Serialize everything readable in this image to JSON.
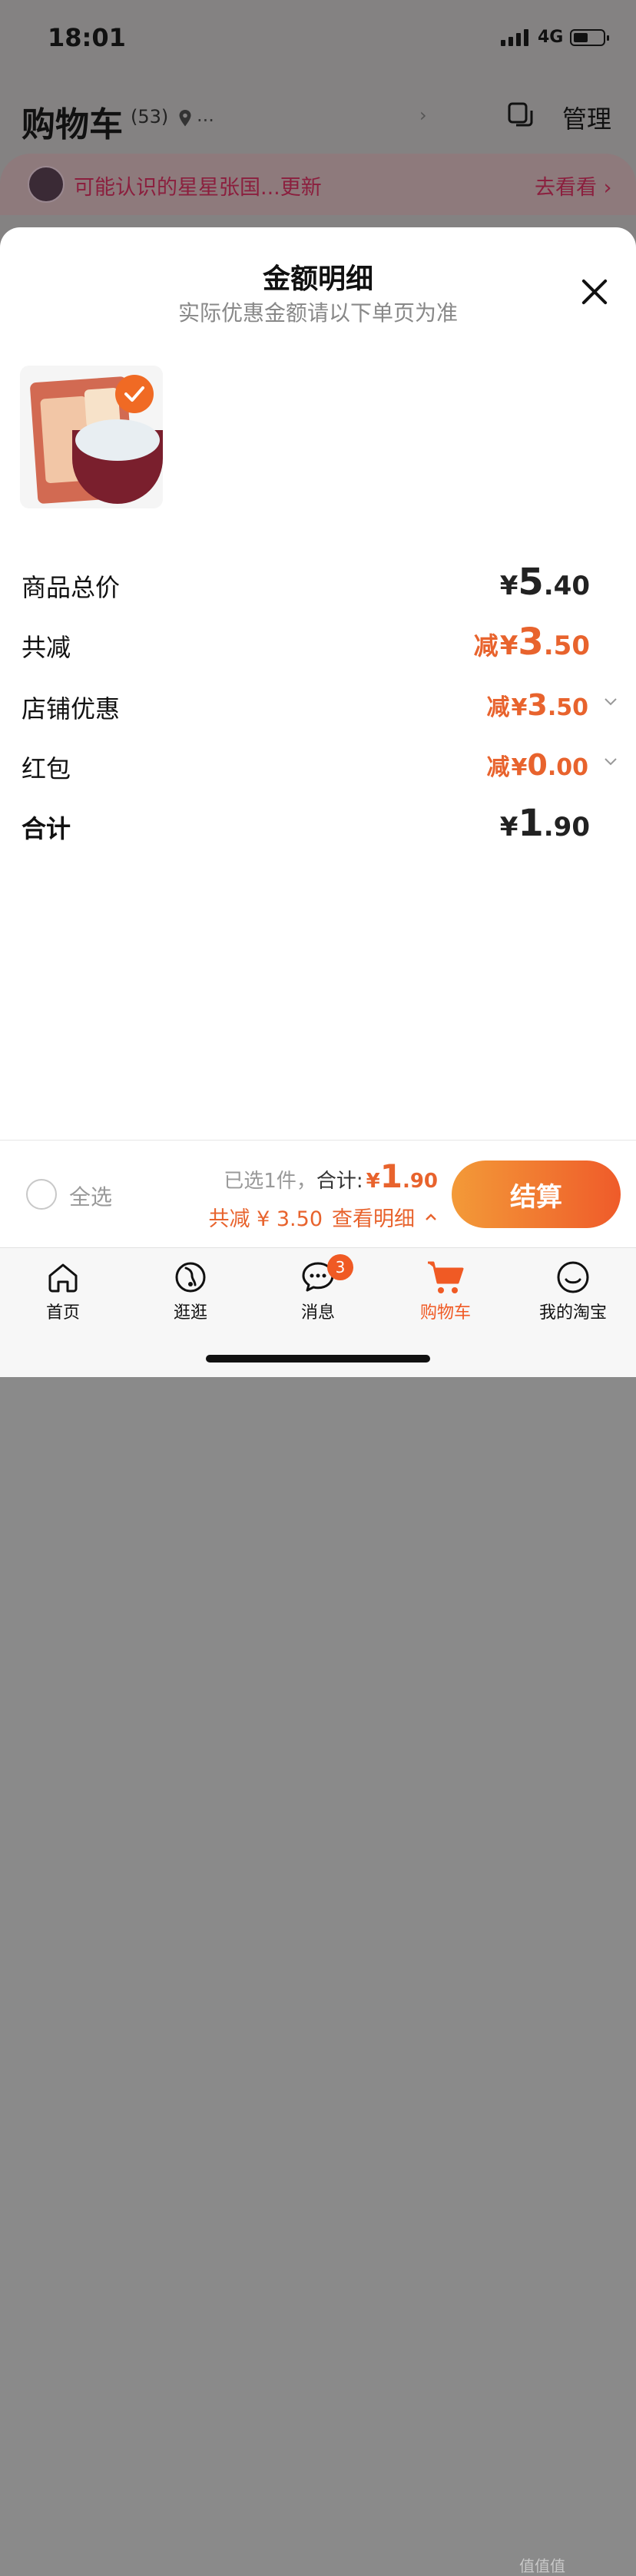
{
  "status_bar": {
    "time": "18:01",
    "network": "4G"
  },
  "header": {
    "title": "购物车",
    "count": "(53)",
    "location": "...",
    "manage": "管理"
  },
  "notice": {
    "text": "可能认识的星星张国...更新",
    "link": "去看看"
  },
  "sheet": {
    "title": "金额明细",
    "subtitle": "实际优惠金额请以下单页为准",
    "rows": [
      {
        "label": "商品总价",
        "prefix": "",
        "yen": "¥",
        "int": "5",
        "dec": ".40"
      },
      {
        "label": "共减",
        "prefix": "减",
        "yen": "¥",
        "int": "3",
        "dec": ".50"
      },
      {
        "label": "店铺优惠",
        "prefix": "减",
        "yen": "¥",
        "int": "3",
        "dec": ".50"
      },
      {
        "label": "红包",
        "prefix": "减",
        "yen": "¥",
        "int": "0",
        "dec": ".00"
      },
      {
        "label": "合计",
        "prefix": "",
        "yen": "¥",
        "int": "1",
        "dec": ".90"
      }
    ]
  },
  "bottom": {
    "select_all": "全选",
    "selected_text": "已选1件，",
    "total_label": "合计:",
    "total_yen": "¥",
    "total_int": "1",
    "total_dec": ".90",
    "discount_text": "共减 ¥ 3.50",
    "details_link": "查看明细",
    "checkout": "结算"
  },
  "tabs": [
    {
      "label": "首页",
      "icon": "home-icon"
    },
    {
      "label": "逛逛",
      "icon": "browse-icon"
    },
    {
      "label": "消息",
      "icon": "message-icon",
      "badge": "3"
    },
    {
      "label": "购物车",
      "icon": "cart-icon"
    },
    {
      "label": "我的淘宝",
      "icon": "profile-icon"
    }
  ],
  "watermark": "值值值",
  "colors": {
    "accent": "#E8632D",
    "checkout_start": "#F39A38",
    "checkout_end": "#EF5B2A"
  }
}
